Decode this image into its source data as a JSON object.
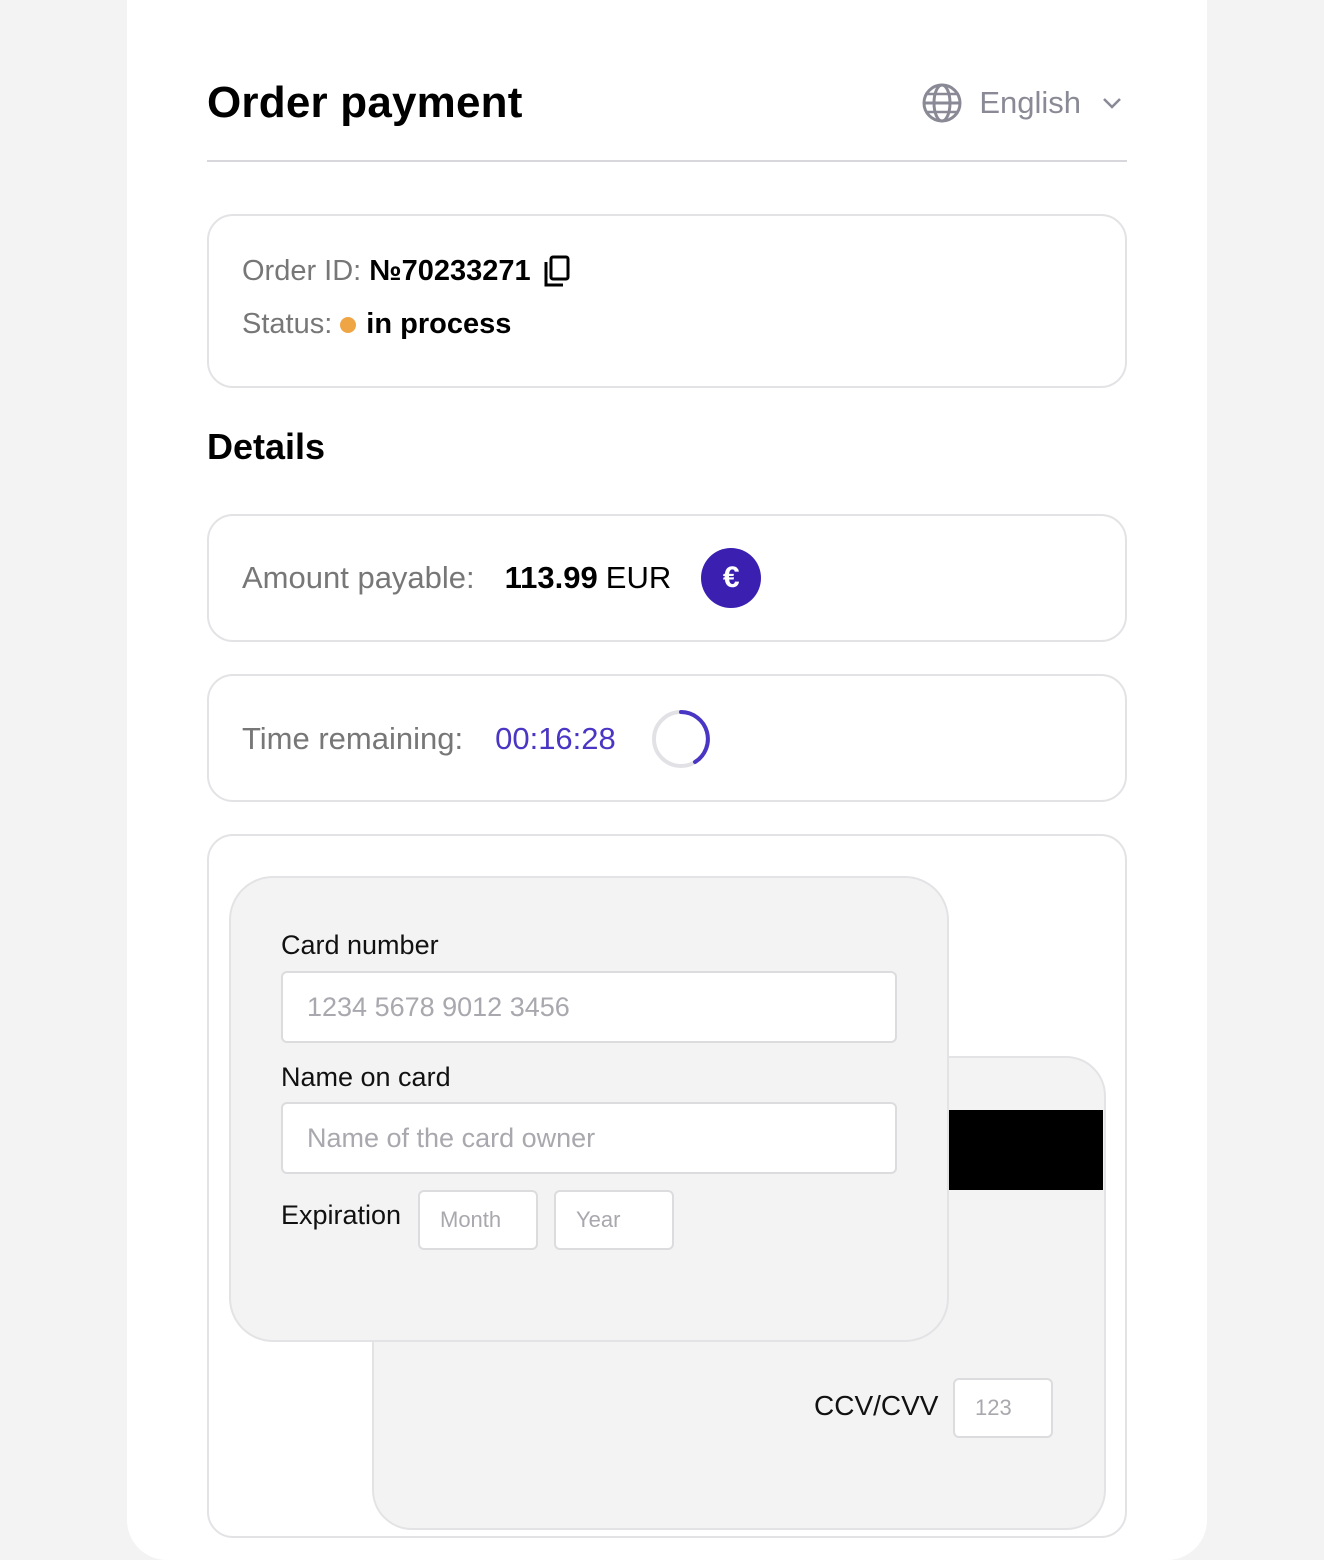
{
  "header": {
    "title": "Order payment",
    "language": "English",
    "language_icon": "globe-icon",
    "dropdown_icon": "chevron-down-icon"
  },
  "order": {
    "id_label": "Order ID:",
    "id_value": "№70233271",
    "copy_icon": "copy-icon",
    "status_label": "Status:",
    "status_value": "in process",
    "status_color": "#f0a545"
  },
  "details": {
    "title": "Details",
    "amount_label": "Amount payable:",
    "amount_value": "113.99",
    "amount_currency": "EUR",
    "currency_symbol": "€",
    "currency_badge_color": "#3a1fb0",
    "time_label": "Time remaining:",
    "time_value": "00:16:28",
    "timer_color": "#4a36c4"
  },
  "card_form": {
    "card_number_label": "Card number",
    "card_number_placeholder": "1234 5678 9012 3456",
    "name_label": "Name on card",
    "name_placeholder": "Name of the card owner",
    "expiration_label": "Expiration",
    "month_placeholder": "Month",
    "year_placeholder": "Year",
    "ccv_label": "CCV/CVV",
    "ccv_placeholder": "123"
  }
}
